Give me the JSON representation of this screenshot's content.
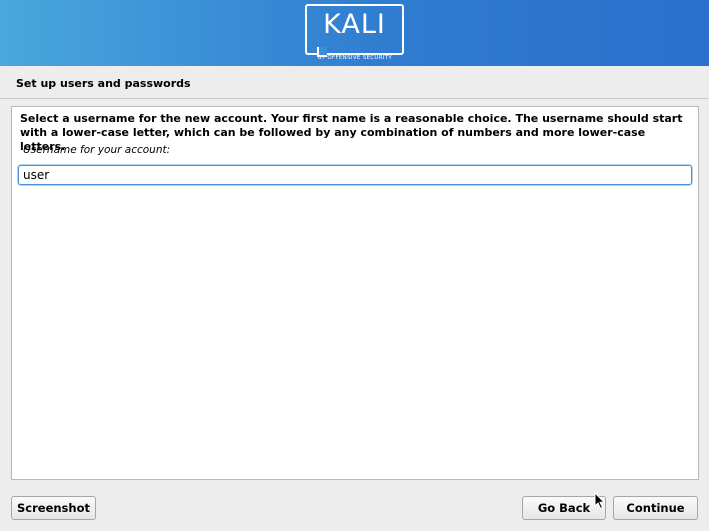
{
  "banner": {
    "logo_text": "KALI",
    "logo_subtitle": "BY OFFENSIVE SECURITY",
    "accent_color": "#2f7cd0"
  },
  "page": {
    "title": "Set up users and passwords"
  },
  "panel": {
    "instructions": "Select a username for the new account. Your first name is a reasonable choice. The username should start with a lower-case letter, which can be followed by any combination of numbers and more lower-case letters.",
    "field_label": "Username for your account:",
    "username_value": "user"
  },
  "buttons": {
    "screenshot": "Screenshot",
    "go_back": "Go Back",
    "continue": "Continue"
  },
  "icons": {
    "pointer": "mouse-pointer-icon"
  }
}
